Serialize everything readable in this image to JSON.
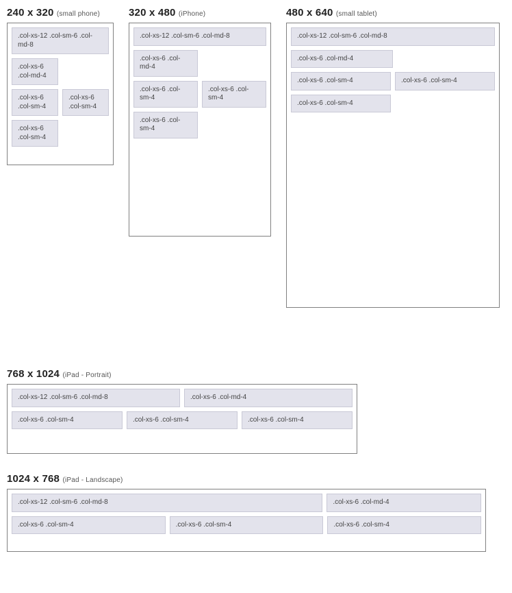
{
  "breakpoints": [
    {
      "dims": "240 x 320",
      "label": "(small phone)",
      "rows": [
        [
          ".col-xs-12 .col-sm-6 .col-md-8"
        ],
        [
          ".col-xs-6 .col-md-4"
        ],
        [
          ".col-xs-6 .col-sm-4",
          ".col-xs-6 .col-sm-4"
        ],
        [
          ".col-xs-6 .col-sm-4"
        ]
      ]
    },
    {
      "dims": "320 x 480",
      "label": "(iPhone)",
      "rows": [
        [
          ".col-xs-12 .col-sm-6 .col-md-8"
        ],
        [
          ".col-xs-6 .col-md-4"
        ],
        [
          ".col-xs-6 .col-sm-4",
          ".col-xs-6 .col-sm-4"
        ],
        [
          ".col-xs-6 .col-sm-4"
        ]
      ]
    },
    {
      "dims": "480 x 640",
      "label": "(small tablet)",
      "rows": [
        [
          ".col-xs-12 .col-sm-6 .col-md-8"
        ],
        [
          ".col-xs-6 .col-md-4"
        ],
        [
          ".col-xs-6 .col-sm-4",
          ".col-xs-6 .col-sm-4"
        ],
        [
          ".col-xs-6 .col-sm-4"
        ]
      ]
    },
    {
      "dims": "768 x 1024",
      "label": "(iPad - Portrait)",
      "rows": [
        [
          ".col-xs-12 .col-sm-6 .col-md-8",
          ".col-xs-6 .col-md-4"
        ],
        [
          ".col-xs-6 .col-sm-4",
          ".col-xs-6 .col-sm-4",
          ".col-xs-6 .col-sm-4"
        ]
      ]
    },
    {
      "dims": "1024 x 768",
      "label": "(iPad - Landscape)",
      "rows": [
        [
          ".col-xs-12 .col-sm-6 .col-md-8",
          ".col-xs-6 .col-md-4"
        ],
        [
          ".col-xs-6 .col-sm-4",
          ".col-xs-6 .col-sm-4",
          ".col-xs-6 .col-sm-4"
        ]
      ]
    }
  ]
}
